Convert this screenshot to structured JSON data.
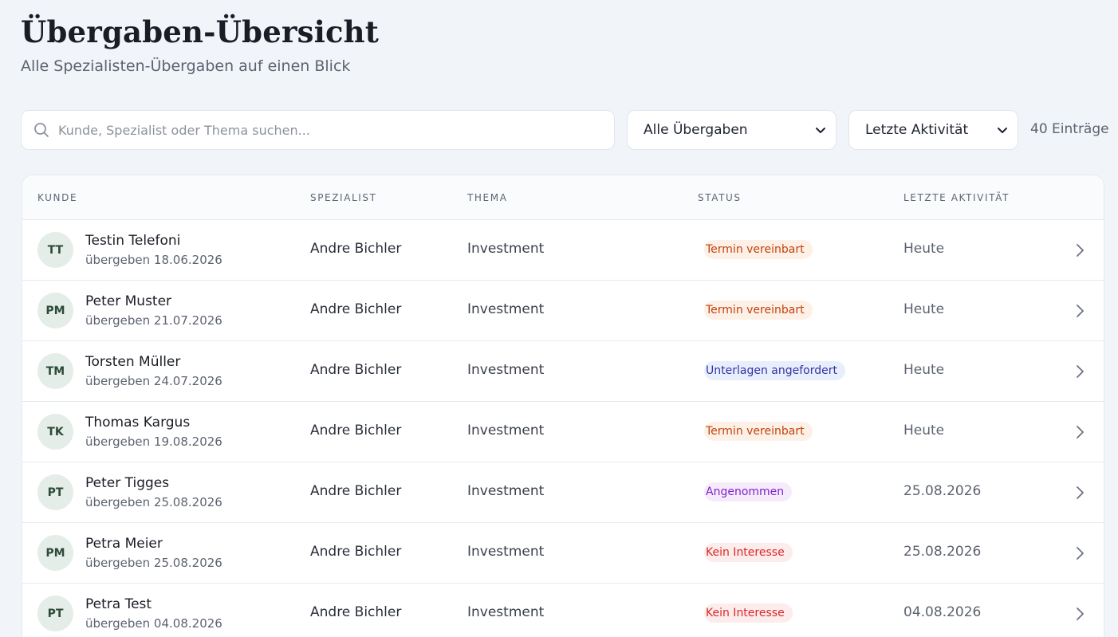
{
  "header": {
    "title": "Übergaben-Übersicht",
    "subtitle": "Alle Spezialisten-Übergaben auf einen Blick"
  },
  "toolbar": {
    "search_placeholder": "Kunde, Spezialist oder Thema suchen...",
    "search_value": "",
    "filter_selected": "Alle Übergaben",
    "sort_selected": "Letzte Aktivität",
    "entry_count": "40 Einträge"
  },
  "table": {
    "columns": [
      "Kunde",
      "Spezialist",
      "Thema",
      "Status",
      "Letzte Aktivität"
    ],
    "rows": [
      {
        "initials": "TT",
        "name": "Testin Telefoni",
        "handover": "übergeben 18.06.2026",
        "specialist": "Andre Bichler",
        "topic": "Investment",
        "status": "Termin vereinbart",
        "status_kind": "scheduled",
        "activity": "Heute"
      },
      {
        "initials": "PM",
        "name": "Peter Muster",
        "handover": "übergeben 21.07.2026",
        "specialist": "Andre Bichler",
        "topic": "Investment",
        "status": "Termin vereinbart",
        "status_kind": "scheduled",
        "activity": "Heute"
      },
      {
        "initials": "TM",
        "name": "Torsten Müller",
        "handover": "übergeben 24.07.2026",
        "specialist": "Andre Bichler",
        "topic": "Investment",
        "status": "Unterlagen angefordert",
        "status_kind": "docs",
        "activity": "Heute"
      },
      {
        "initials": "TK",
        "name": "Thomas Kargus",
        "handover": "übergeben 19.08.2026",
        "specialist": "Andre Bichler",
        "topic": "Investment",
        "status": "Termin vereinbart",
        "status_kind": "scheduled",
        "activity": "Heute"
      },
      {
        "initials": "PT",
        "name": "Peter Tigges",
        "handover": "übergeben 25.08.2026",
        "specialist": "Andre Bichler",
        "topic": "Investment",
        "status": "Angenommen",
        "status_kind": "accepted",
        "activity": "25.08.2026"
      },
      {
        "initials": "PM",
        "name": "Petra Meier",
        "handover": "übergeben 25.08.2026",
        "specialist": "Andre Bichler",
        "topic": "Investment",
        "status": "Kein Interesse",
        "status_kind": "declined",
        "activity": "25.08.2026"
      },
      {
        "initials": "PT",
        "name": "Petra Test",
        "handover": "übergeben 04.08.2026",
        "specialist": "Andre Bichler",
        "topic": "Investment",
        "status": "Kein Interesse",
        "status_kind": "declined",
        "activity": "04.08.2026"
      }
    ]
  },
  "status_colors": {
    "scheduled": {
      "bg": "#fdf1e7",
      "fg": "#c2410c"
    },
    "docs": {
      "bg": "#e8effc",
      "fg": "#3730a3"
    },
    "accepted": {
      "bg": "#f6ebfb",
      "fg": "#7e22ce"
    },
    "declined": {
      "bg": "#fdecec",
      "fg": "#dc2626"
    }
  },
  "icons": {
    "search": "search-icon",
    "select_chevron": "chevron-down-icon",
    "row_chevron": "chevron-right-icon"
  }
}
